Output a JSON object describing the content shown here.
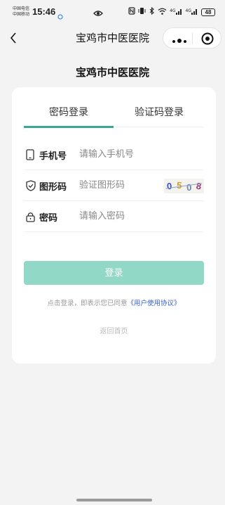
{
  "status_bar": {
    "carrier_1": "中国电信",
    "carrier_2": "中国移动",
    "time": "15:46",
    "network_1": "4G",
    "network_2": "4G",
    "battery": "48"
  },
  "nav": {
    "title": "宝鸡市中医医院"
  },
  "page": {
    "title": "宝鸡市中医医院"
  },
  "tabs": [
    {
      "label": "密码登录",
      "active": true
    },
    {
      "label": "验证码登录",
      "active": false
    }
  ],
  "form": {
    "phone_label": "手机号",
    "phone_placeholder": "请输入手机号",
    "captcha_label": "图形码",
    "captcha_placeholder": "验证图形码",
    "captcha_code": [
      "0",
      "5",
      "0",
      "8"
    ],
    "password_label": "密码",
    "password_placeholder": "请输入密码"
  },
  "login_button": "登录",
  "agreement": {
    "prefix": "点击登录，即表示您已同意",
    "link": "《用户使用协议》"
  },
  "back_home": "返回首页",
  "colors": {
    "accent": "#3aa892",
    "button_disabled": "#92d8c6",
    "link": "#3760c9"
  }
}
